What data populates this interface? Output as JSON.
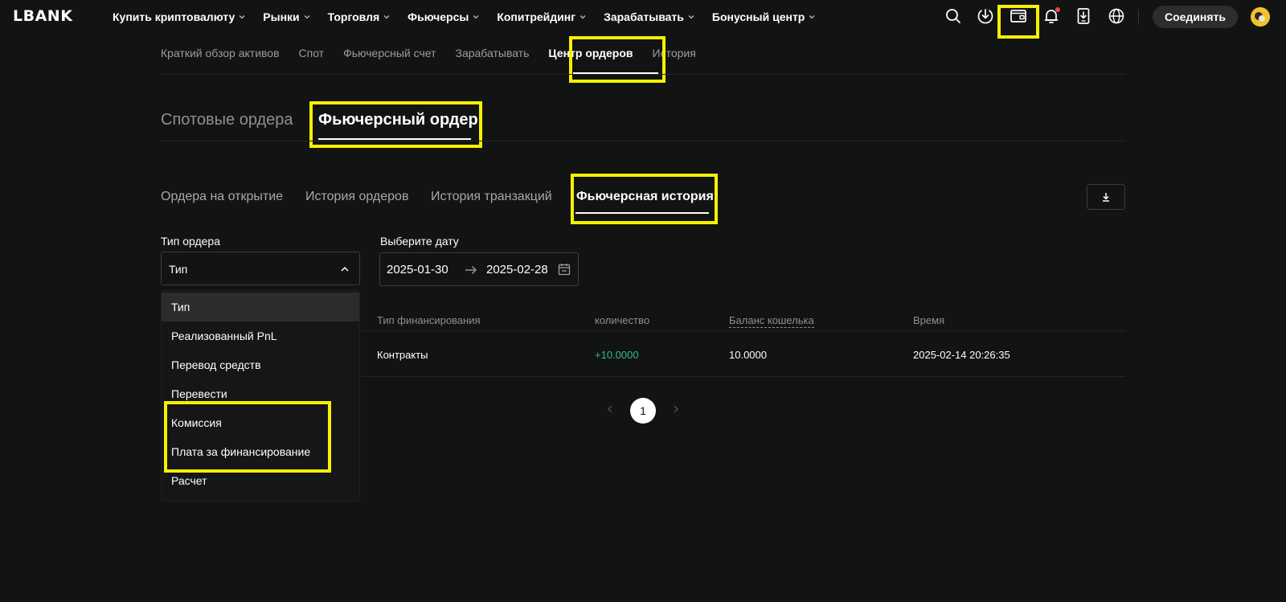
{
  "header": {
    "logo": "LBANK",
    "nav": [
      {
        "label": "Купить криптовалюту",
        "has_dropdown": true
      },
      {
        "label": "Рынки",
        "has_dropdown": true
      },
      {
        "label": "Торговля",
        "has_dropdown": true
      },
      {
        "label": "Фьючерсы",
        "has_dropdown": true
      },
      {
        "label": "Копитрейдинг",
        "has_dropdown": true
      },
      {
        "label": "Зарабатывать",
        "has_dropdown": true
      },
      {
        "label": "Бонусный центр",
        "has_dropdown": true
      }
    ],
    "icons": [
      "search-icon",
      "download-icon",
      "wallet-icon",
      "bell-icon",
      "app-download-icon",
      "globe-icon"
    ],
    "connect_label": "Соединять",
    "notification_dot_color": "#e5484d"
  },
  "account_tabs": [
    {
      "label": "Краткий обзор активов",
      "active": false
    },
    {
      "label": "Спот",
      "active": false
    },
    {
      "label": "Фьючерсный счет",
      "active": false
    },
    {
      "label": "Зарабатывать",
      "active": false
    },
    {
      "label": "Центр ордеров",
      "active": true
    },
    {
      "label": "История",
      "active": false
    }
  ],
  "order_tabs": [
    {
      "label": "Спотовые ордера",
      "active": false
    },
    {
      "label": "Фьючерсный ордер",
      "active": true
    }
  ],
  "sub_tabs": [
    {
      "label": "Ордера на открытие",
      "active": false
    },
    {
      "label": "История ордеров",
      "active": false
    },
    {
      "label": "История транзакций",
      "active": false
    },
    {
      "label": "Фьючерсная история",
      "active": true
    }
  ],
  "filters": {
    "order_type_label": "Тип ордера",
    "order_type_value": "Тип",
    "date_label": "Выберите дату",
    "date_from": "2025-01-30",
    "date_to": "2025-02-28"
  },
  "dropdown_options": [
    {
      "label": "Тип",
      "selected": true
    },
    {
      "label": "Реализованный PnL",
      "selected": false
    },
    {
      "label": "Перевод средств",
      "selected": false
    },
    {
      "label": "Перевести",
      "selected": false
    },
    {
      "label": "Комиссия",
      "selected": false
    },
    {
      "label": "Плата за финансирование",
      "selected": false
    },
    {
      "label": "Расчет",
      "selected": false
    }
  ],
  "table": {
    "columns": [
      "Тип финансирования",
      "количество",
      "Баланс кошелька",
      "Время"
    ],
    "rows": [
      [
        "Контракты",
        "+10.0000",
        "10.0000",
        "2025-02-14 20:26:35"
      ]
    ]
  },
  "pagination": {
    "current": "1"
  },
  "colors": {
    "highlight": "#f4f100",
    "positive": "#2ebd85",
    "background": "#121313"
  }
}
